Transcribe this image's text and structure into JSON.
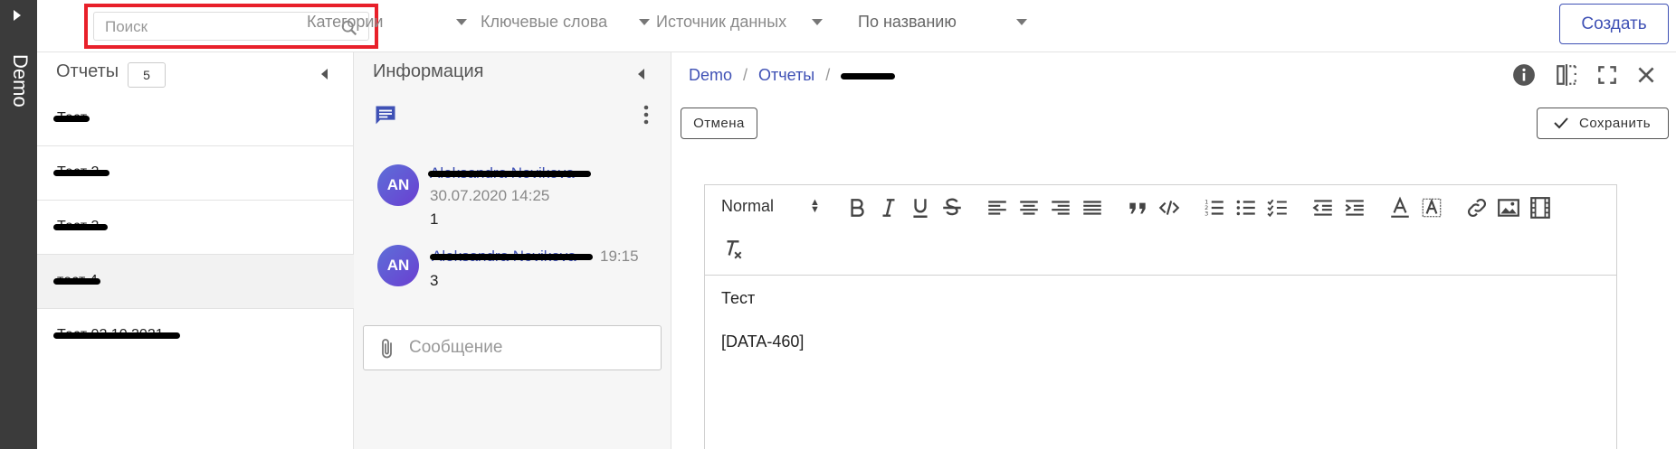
{
  "rail": {
    "label": "Demo"
  },
  "topbar": {
    "search_placeholder": "Поиск",
    "filters": [
      "Категории",
      "Ключевые слова",
      "Источник данных",
      "По названию"
    ],
    "create_label": "Создать"
  },
  "reports": {
    "title": "Отчеты",
    "count": "5",
    "items": [
      "Тест",
      "Тест 2",
      "Тест 3",
      "тест 4",
      "Тест 02.10.2021"
    ]
  },
  "info": {
    "title": "Информация",
    "comments": [
      {
        "initials": "AN",
        "author": "Aleksandra Novikova",
        "date": "30.07.2020 14:25",
        "text": "1"
      },
      {
        "initials": "AN",
        "author": "Aleksandra Novikova",
        "date": "19:15",
        "text": "3"
      }
    ],
    "message_placeholder": "Сообщение"
  },
  "editor": {
    "breadcrumb": [
      "Demo",
      "Отчеты"
    ],
    "cancel_label": "Отмена",
    "save_label": "Сохранить",
    "format_select": "Normal",
    "content": [
      "Тест",
      "[DATA-460]"
    ]
  },
  "colors": {
    "accent": "#3f51b5",
    "highlight": "#e8202a",
    "rail": "#3b3b3b"
  }
}
